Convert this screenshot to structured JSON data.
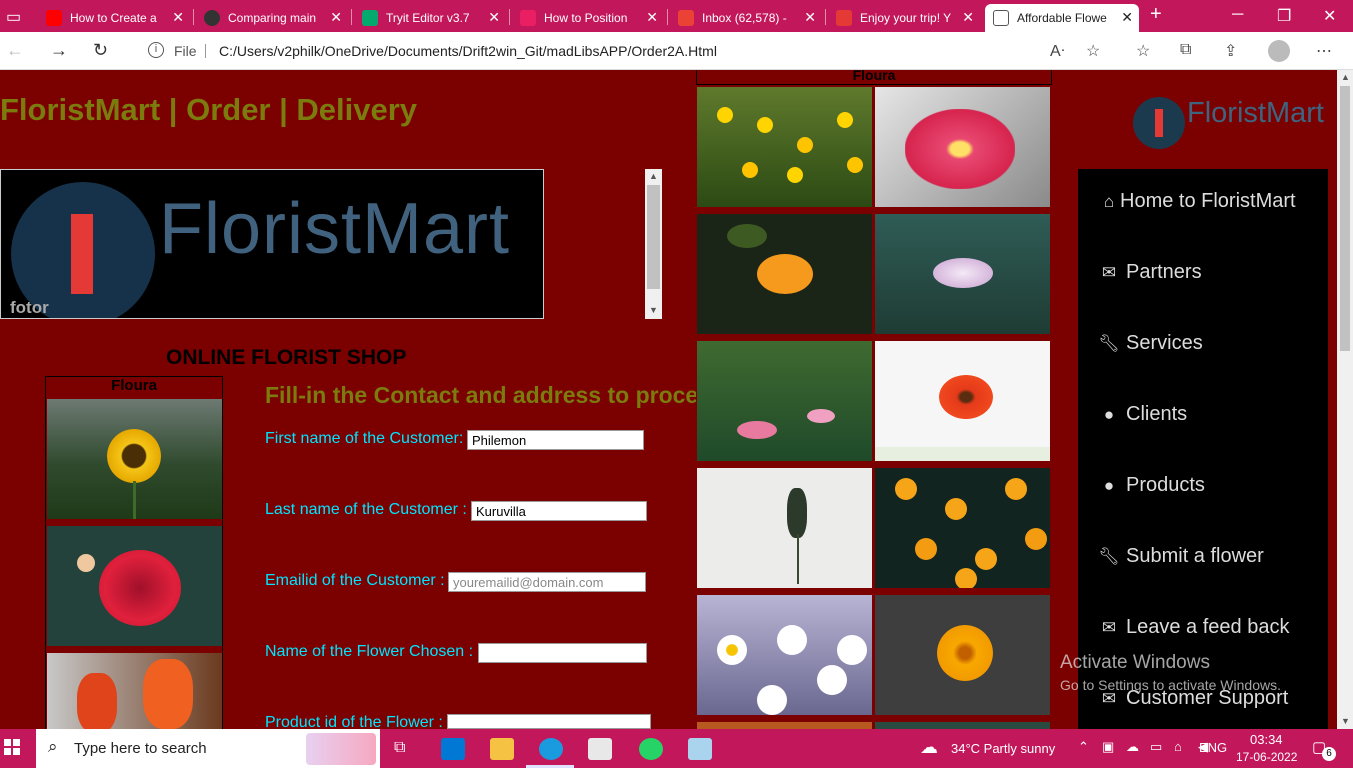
{
  "browser": {
    "tabs": [
      {
        "label": "How to Create a",
        "color": "#ff0000"
      },
      {
        "label": "Comparing main",
        "color": "#333333"
      },
      {
        "label": "Tryit Editor v3.7",
        "color": "#04aa6d"
      },
      {
        "label": "How to Position",
        "color": "#e91e63"
      },
      {
        "label": "Inbox (62,578) -",
        "color": "#ea4335"
      },
      {
        "label": "Enjoy your trip! Y",
        "color": "#e53935"
      },
      {
        "label": "Affordable Flowe",
        "color": "#555555"
      }
    ],
    "file_label": "File",
    "url": "C:/Users/v2philk/OneDrive/Documents/Drift2win_Git/madLibsAPP/Order2A.Html"
  },
  "page": {
    "title": "FloristMart | Order | Delivery",
    "banner_text": "FloristMart",
    "banner_watermark": "fotor",
    "shop_heading": "ONLINE FLORIST SHOP",
    "gallery_caption": "Floura",
    "form_heading": "Fill-in the Contact and address to process your order for delivery",
    "form": {
      "first_name_label": "First name of the Customer:",
      "first_name_value": "Philemon",
      "last_name_label": "Last name of the Customer :",
      "last_name_value": "Kuruvilla",
      "email_label": "Emailid of the Customer :",
      "email_placeholder": "youremailid@domain.com",
      "flower_label": "Name of the Flower Chosen :",
      "flower_value": "",
      "product_label": "Product id of the Flower :",
      "product_value": ""
    },
    "logo_text": "FloristMart",
    "nav": [
      {
        "label": "Home to FloristMart",
        "icon": "home-icon"
      },
      {
        "label": "Partners",
        "icon": "envelope-icon"
      },
      {
        "label": "Services",
        "icon": "wrench-icon"
      },
      {
        "label": "Clients",
        "icon": "user-icon"
      },
      {
        "label": "Products",
        "icon": "user-icon"
      },
      {
        "label": "Submit a flower",
        "icon": "wrench-icon"
      },
      {
        "label": "Leave a feed back",
        "icon": "envelope-icon"
      },
      {
        "label": "Customer Support",
        "icon": "envelope-icon"
      }
    ],
    "watermark_title": "Activate Windows",
    "watermark_sub": "Go to Settings to activate Windows."
  },
  "taskbar": {
    "search_placeholder": "Type here to search",
    "weather": "34°C  Partly sunny",
    "language": "ENG",
    "time": "03:34",
    "date": "17-06-2022",
    "notifications": "6"
  },
  "colors": {
    "page_bg": "#7b0000",
    "accent": "#c2185b",
    "title": "#7b7b0e",
    "form_label": "#00e5ff"
  }
}
